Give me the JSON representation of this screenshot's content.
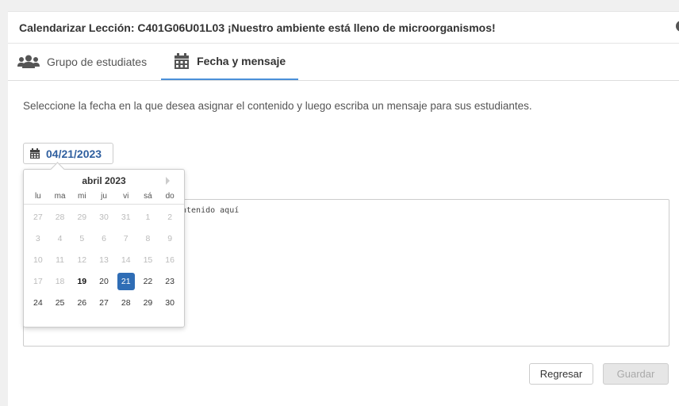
{
  "modal": {
    "title": "Calendarizar Lección: C401G06U01L03 ¡Nuestro ambiente está lleno de microorganismos!"
  },
  "tabs": [
    {
      "label": "Grupo de estudiates",
      "icon": "users-icon",
      "active": false
    },
    {
      "label": "Fecha y mensaje",
      "icon": "calendar-icon",
      "active": true
    }
  ],
  "instruction": "Seleccione la fecha en la que desea asignar el contenido y luego escriba un mensaje para sus estudiantes.",
  "date_field": {
    "value": "04/21/2023",
    "icon": "calendar-icon"
  },
  "datepicker": {
    "month_label": "abril 2023",
    "weekdays": [
      "lu",
      "ma",
      "mi",
      "ju",
      "vi",
      "sá",
      "do"
    ],
    "days": [
      [
        "27",
        "28",
        "29",
        "30",
        "31",
        "1",
        "2"
      ],
      [
        "3",
        "4",
        "5",
        "6",
        "7",
        "8",
        "9"
      ],
      [
        "10",
        "11",
        "12",
        "13",
        "14",
        "15",
        "16"
      ],
      [
        "17",
        "18",
        "19",
        "20",
        "21",
        "22",
        "23"
      ],
      [
        "24",
        "25",
        "26",
        "27",
        "28",
        "29",
        "30"
      ]
    ],
    "selected": "21",
    "today": "19"
  },
  "message": {
    "placeholder_visible": "ntenido aquí"
  },
  "buttons": {
    "back": "Regresar",
    "save": "Guardar"
  },
  "colors": {
    "accent": "#4a90d9",
    "date_text": "#2f5f9f",
    "selected_day": "#2f6db5",
    "icon": "#555"
  }
}
